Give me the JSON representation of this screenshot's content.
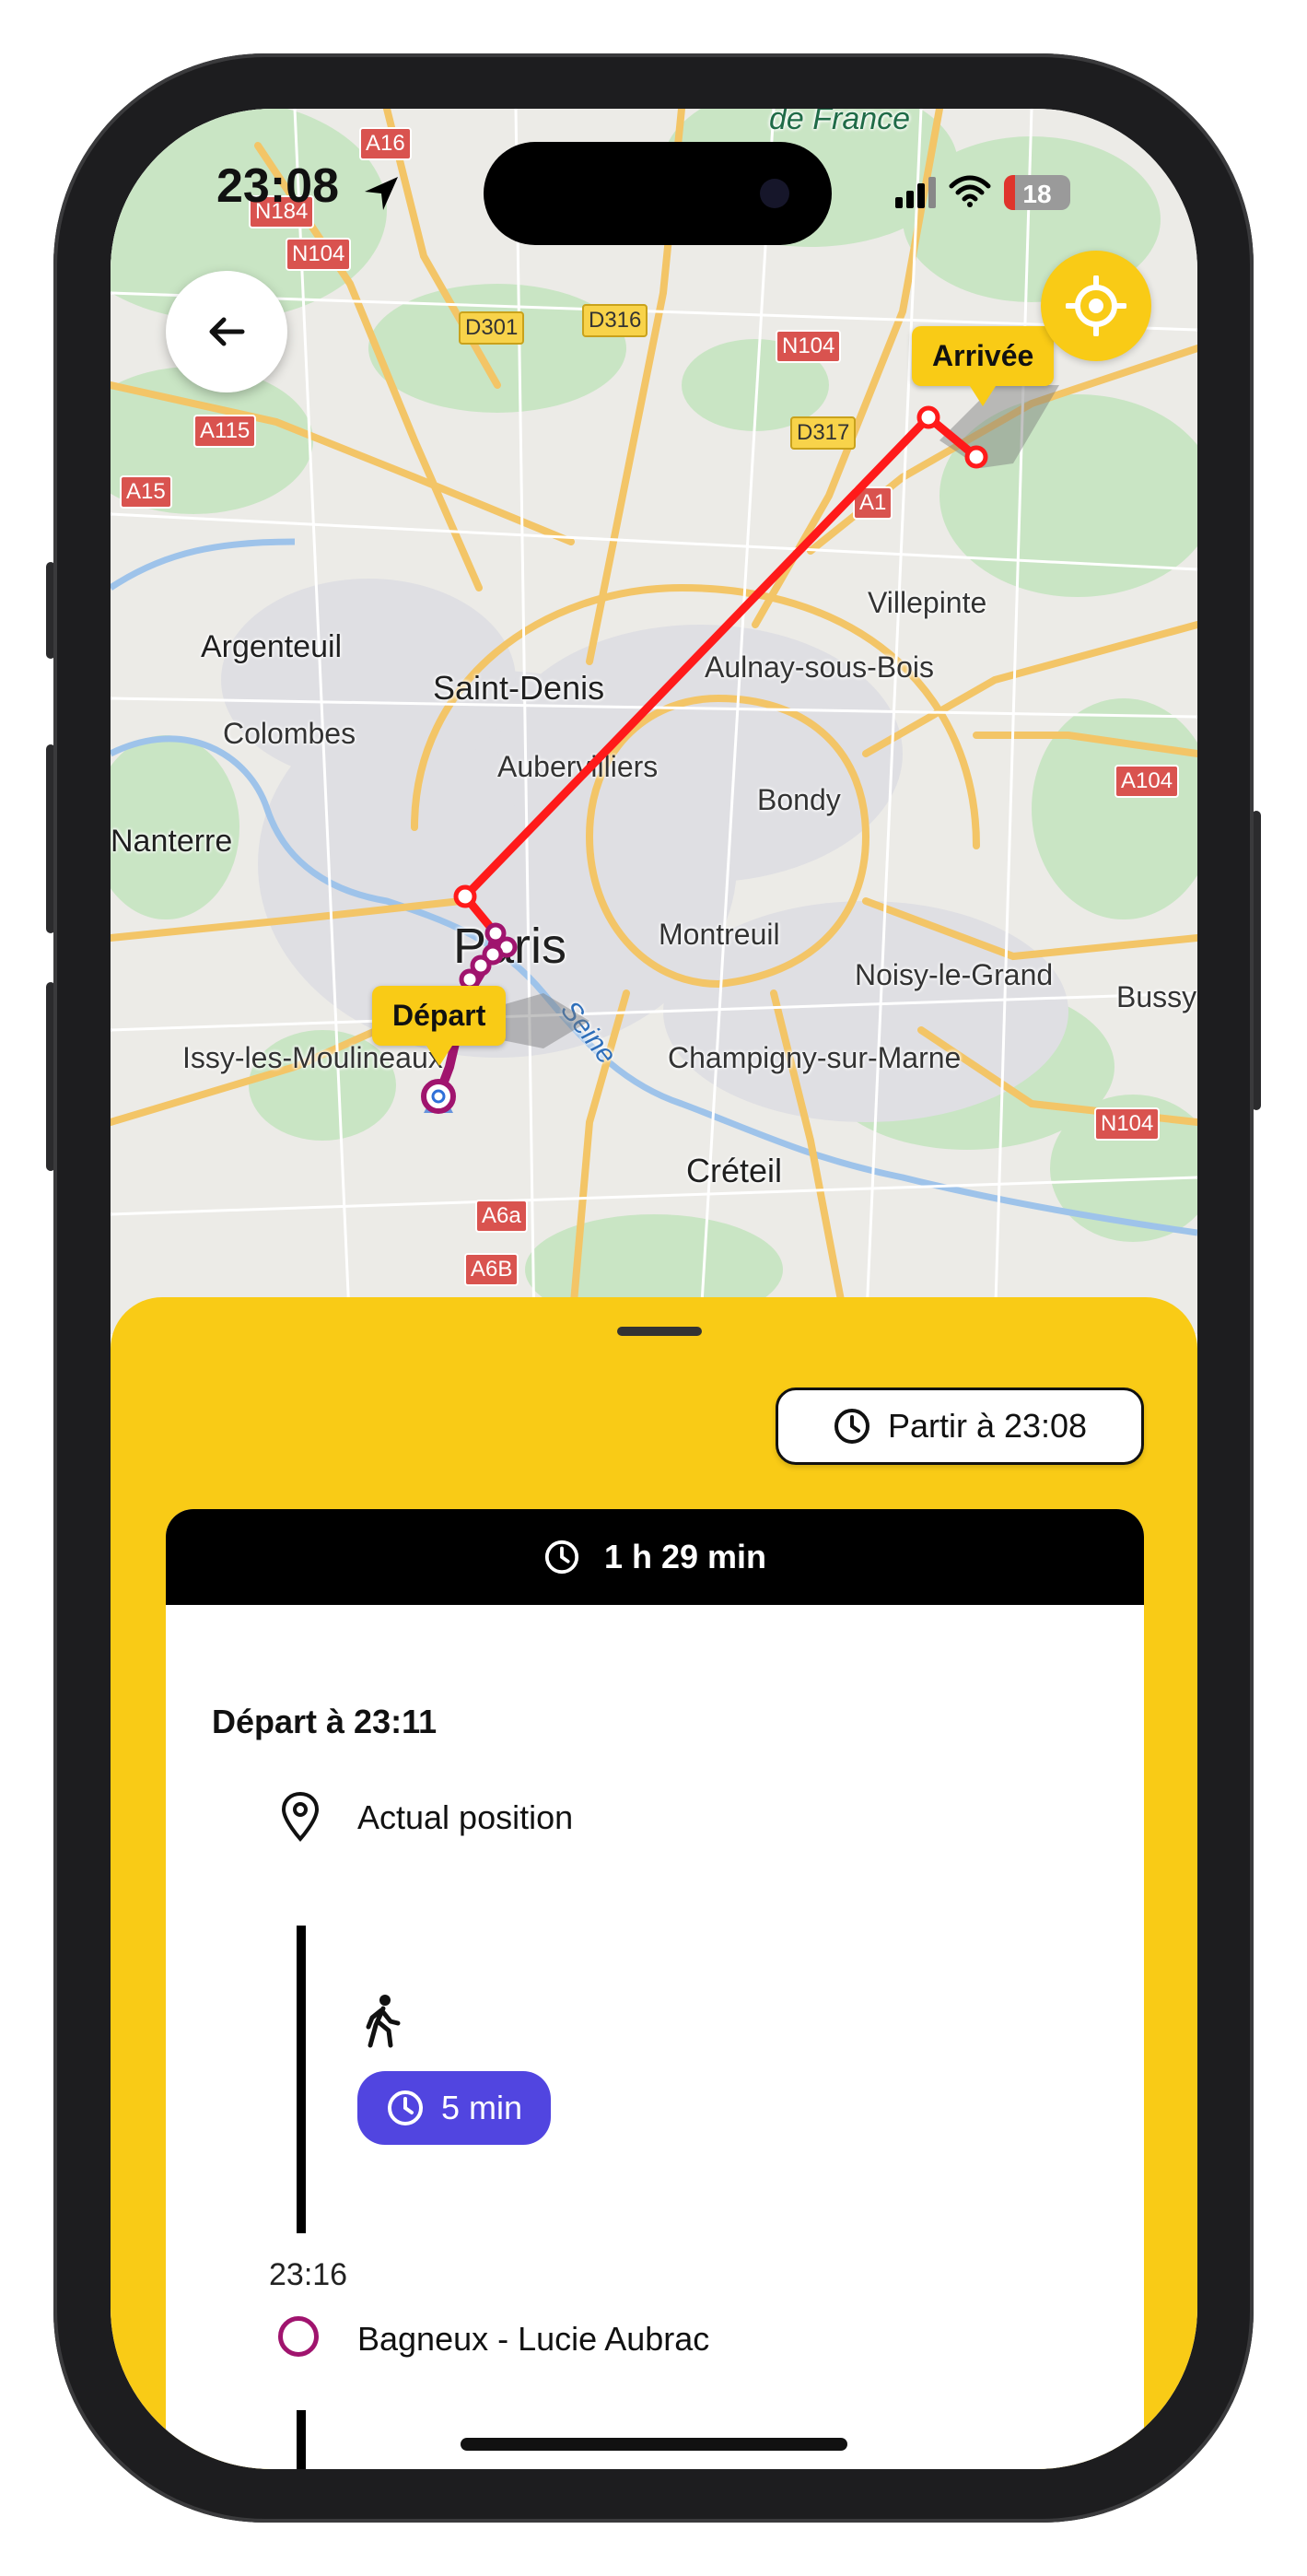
{
  "status_bar": {
    "time": "23:08",
    "battery": "18"
  },
  "map": {
    "labels": {
      "region": "de France",
      "argenteuil": "Argenteuil",
      "saint_denis": "Saint-Denis",
      "colombes": "Colombes",
      "aubervilliers": "Aubervilliers",
      "nanterre": "Nanterre",
      "paris": "Paris",
      "montreuil": "Montreuil",
      "bondy": "Bondy",
      "aulnay": "Aulnay-sous-Bois",
      "villepinte": "Villepinte",
      "noisy": "Noisy-le-Grand",
      "bussy": "Bussy",
      "issy": "Issy-les-Moulineaux",
      "champigny": "Champigny-sur-Marne",
      "creteil": "Créteil",
      "seine": "Seine"
    },
    "roads": {
      "a16": "A16",
      "n184": "N184",
      "n104_a": "N104",
      "d301": "D301",
      "d316": "D316",
      "n104_b": "N104",
      "d317": "D317",
      "a1": "A1",
      "a115": "A115",
      "a15": "A15",
      "a104": "A104",
      "n104_c": "N104",
      "a6a": "A6a",
      "a6b": "A6B"
    },
    "markers": {
      "arrival": "Arrivée",
      "departure": "Départ"
    },
    "colors": {
      "route": "#ff1a1a",
      "metro": "#a0146e",
      "accent": "#f9cb16"
    }
  },
  "sheet": {
    "partir_label": "Partir à 23:08",
    "duration": "1 h 29 min",
    "departure_heading": "Départ à 23:11",
    "origin": "Actual position",
    "walk_duration": "5 min",
    "stop_time": "23:16",
    "stop_name": "Bagneux - Lucie Aubrac"
  }
}
